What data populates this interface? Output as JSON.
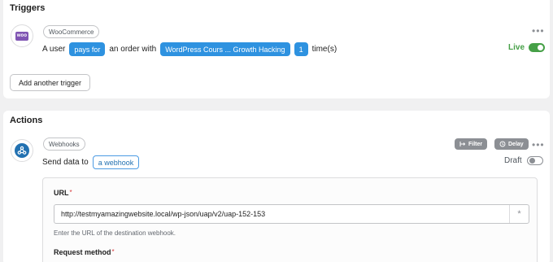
{
  "triggers": {
    "title": "Triggers",
    "app_badge": "WooCommerce",
    "app_logo_text": "woo",
    "sentence": {
      "a_user": "A user",
      "verb_token": "pays for",
      "middle": "an order with",
      "product_token": "WordPress Cours ... Growth Hacking",
      "count_token": "1",
      "suffix": "time(s)"
    },
    "status_label": "Live",
    "add_button": "Add another trigger",
    "more_menu": "•••"
  },
  "actions": {
    "title": "Actions",
    "app_badge": "Webhooks",
    "sentence": {
      "prefix": "Send data to",
      "target_token": "a webhook"
    },
    "filter_button": "Filter",
    "delay_button": "Delay",
    "more_menu": "•••",
    "status_label": "Draft",
    "form": {
      "url_label": "URL",
      "required_mark": "*",
      "url_value": "http://testmyamazingwebsite.local/wp-json/uap/v2/uap-152-153",
      "token_button": "*",
      "url_help": "Enter the URL of the destination webhook.",
      "method_label": "Request method"
    }
  },
  "colors": {
    "accent": "#2e92e0",
    "live_green": "#46a047",
    "woo_purple": "#7f54b3",
    "webhook_blue": "#2271b1",
    "required_red": "#d63638"
  }
}
